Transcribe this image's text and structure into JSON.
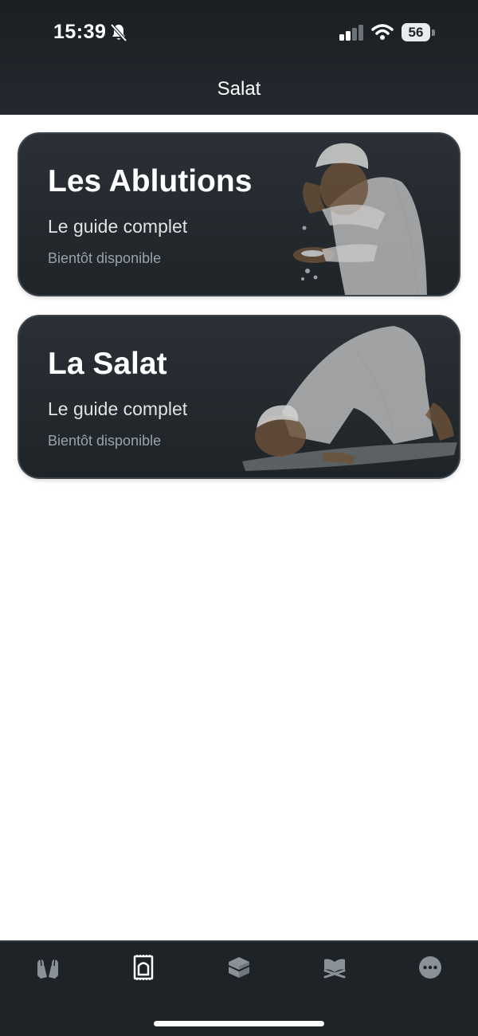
{
  "status_bar": {
    "time": "15:39",
    "icons": [
      "bell-slash-icon",
      "cellular-signal-icon",
      "wifi-icon"
    ],
    "battery_level": "56"
  },
  "header": {
    "title": "Salat"
  },
  "cards": [
    {
      "title": "Les Ablutions",
      "subtitle": "Le guide complet",
      "status": "Bientôt disponible",
      "illustration": "ablution-illustration"
    },
    {
      "title": "La Salat",
      "subtitle": "Le guide complet",
      "status": "Bientôt disponible",
      "illustration": "prostration-illustration"
    }
  ],
  "tab_bar": {
    "tabs": [
      {
        "icon": "praying-hands-icon",
        "active": false
      },
      {
        "icon": "prayer-mat-icon",
        "active": true
      },
      {
        "icon": "kaaba-icon",
        "active": false
      },
      {
        "icon": "quran-stand-icon",
        "active": false
      },
      {
        "icon": "more-icon",
        "active": false
      }
    ]
  },
  "colors": {
    "header_bg": "#1b1f23",
    "card_bg": "#262c31",
    "tab_active": "#ffffff",
    "tab_inactive": "#8a9198"
  }
}
